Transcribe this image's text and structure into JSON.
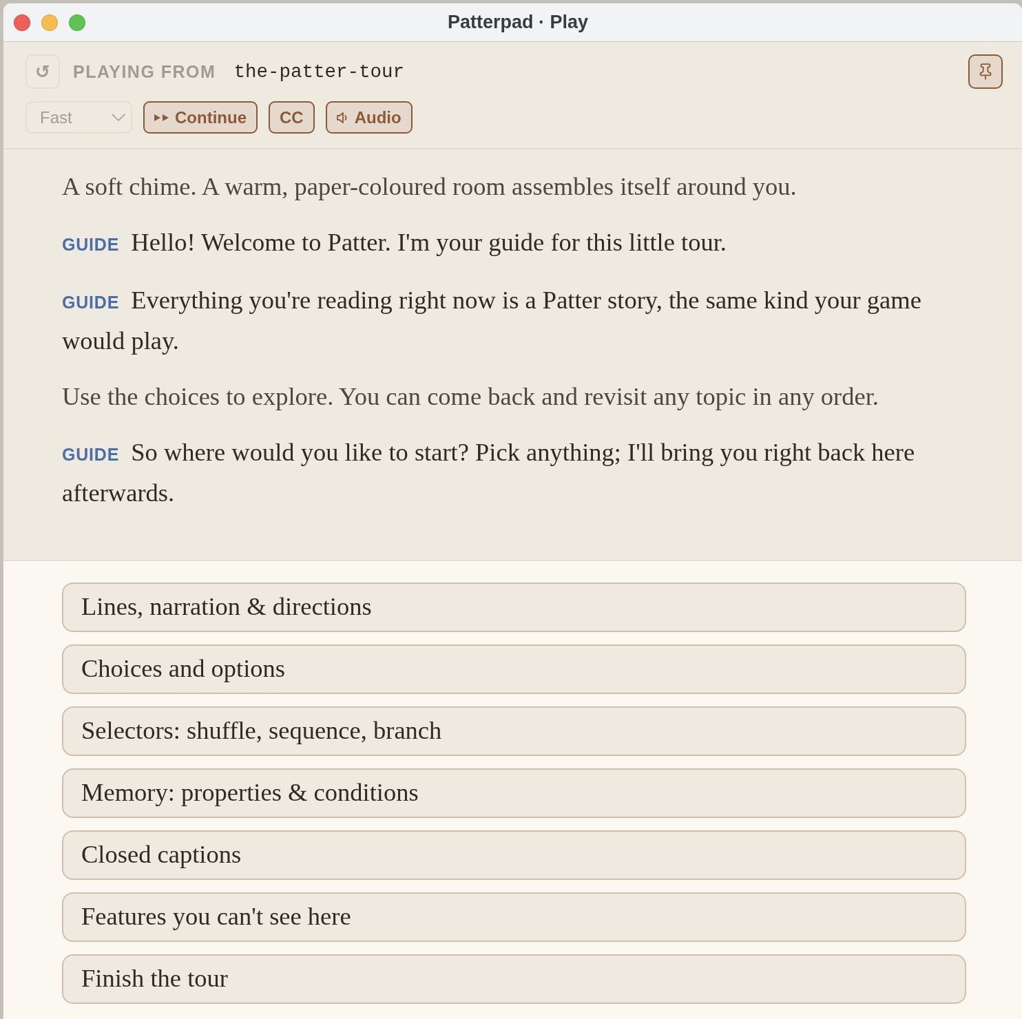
{
  "window": {
    "title": "Patterpad · Play"
  },
  "toolbar": {
    "restart": {
      "glyph": "↺",
      "disabled": true
    },
    "source_label": "PLAYING FROM",
    "source_name": "the-patter-tour",
    "speed": {
      "value": "Fast",
      "disabled": true
    },
    "buttons": [
      {
        "kind": "continue",
        "label": "Continue"
      },
      {
        "kind": "captions",
        "label": "CC"
      },
      {
        "kind": "audio",
        "label": "Audio"
      }
    ]
  },
  "story": [
    {
      "kind": "narration",
      "text": "A soft chime. A warm, paper-coloured room assembles itself around you."
    },
    {
      "kind": "line",
      "speaker": "GUIDE",
      "text": "Hello! Welcome to Patter. I'm your guide for this little tour."
    },
    {
      "kind": "line",
      "speaker": "GUIDE",
      "text": "Everything you're reading right now is a Patter story, the same kind your game would play."
    },
    {
      "kind": "narration",
      "text": "Use the choices to explore. You can come back and revisit any topic in any order."
    },
    {
      "kind": "line",
      "speaker": "GUIDE",
      "text": "So where would you like to start? Pick anything; I'll bring you right back here afterwards."
    }
  ],
  "choices": [
    {
      "label": "Lines, narration & directions"
    },
    {
      "label": "Choices and options"
    },
    {
      "label": "Selectors: shuffle, sequence, branch"
    },
    {
      "label": "Memory: properties & conditions"
    },
    {
      "label": "Closed captions"
    },
    {
      "label": "Features you can't see here"
    },
    {
      "label": "Finish the tour"
    }
  ]
}
